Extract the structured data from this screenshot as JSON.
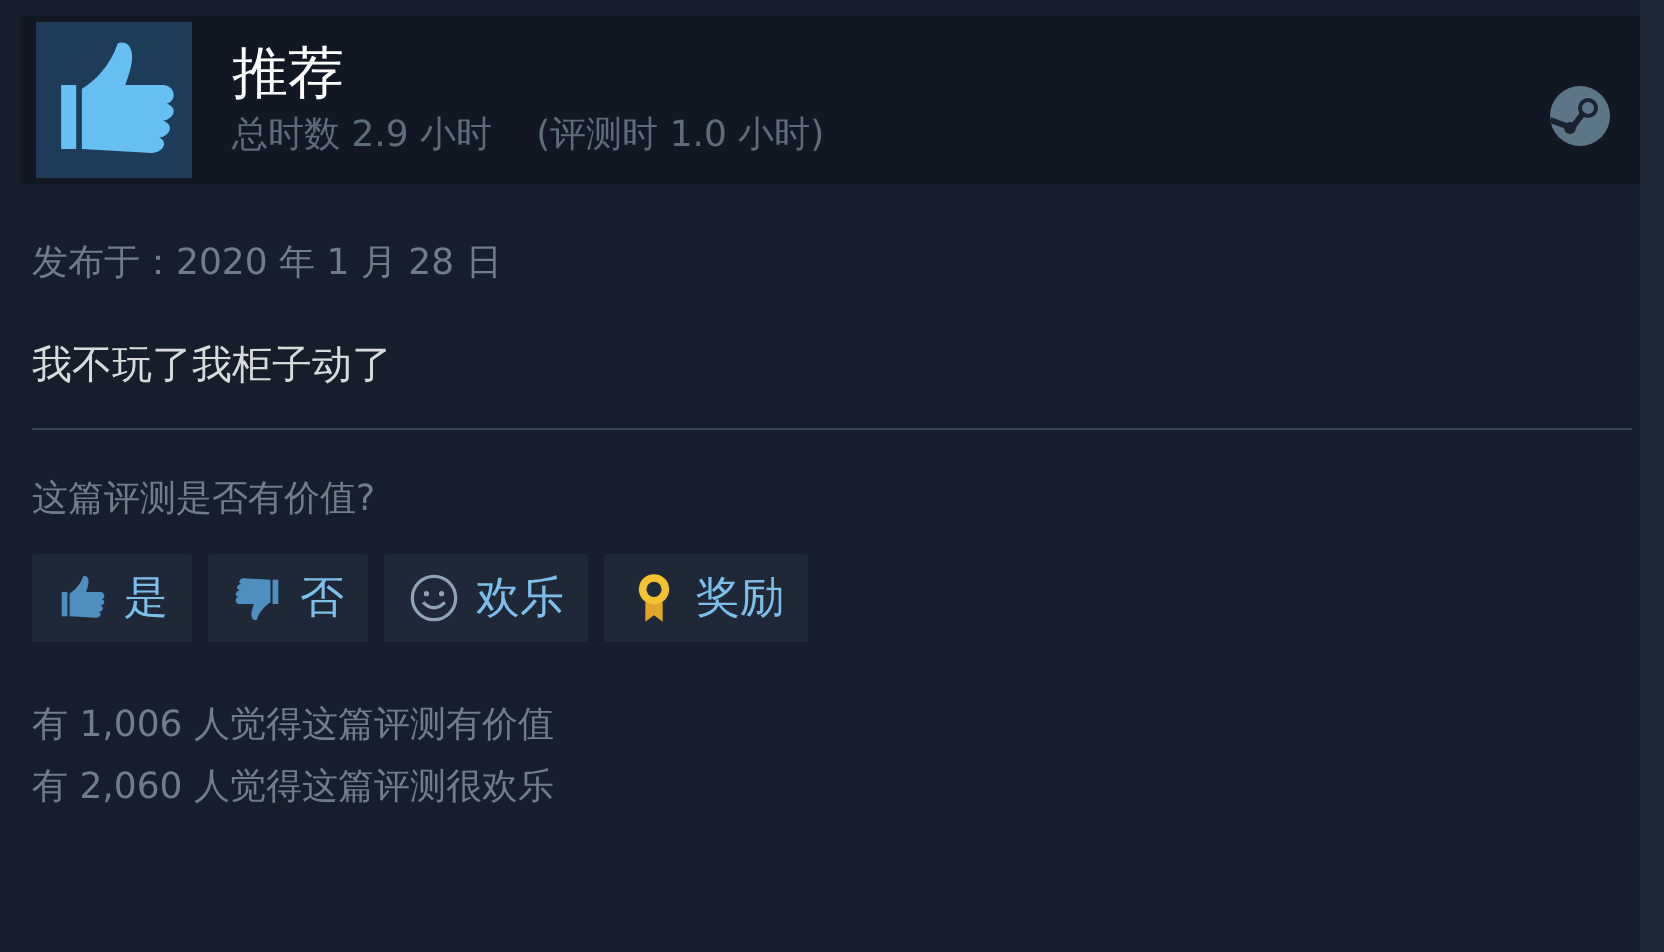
{
  "review": {
    "verdict": "推荐",
    "kind": "recommended",
    "hours": "总时数 2.9 小时",
    "hours_at_review": "(评测时 1.0 小时)"
  },
  "posted": "发布于：2020 年 1 月 28 日",
  "text": "我不玩了我柜子动了",
  "question": "这篇评测是否有价值?",
  "buttons": [
    {
      "kind": "yes",
      "label": "是"
    },
    {
      "kind": "no",
      "label": "否"
    },
    {
      "kind": "funny",
      "label": "欢乐"
    },
    {
      "kind": "award",
      "label": "奖励"
    }
  ],
  "counts": [
    "有 1,006 人觉得这篇评测有价值",
    "有 2,060 人觉得这篇评测很欢乐"
  ]
}
